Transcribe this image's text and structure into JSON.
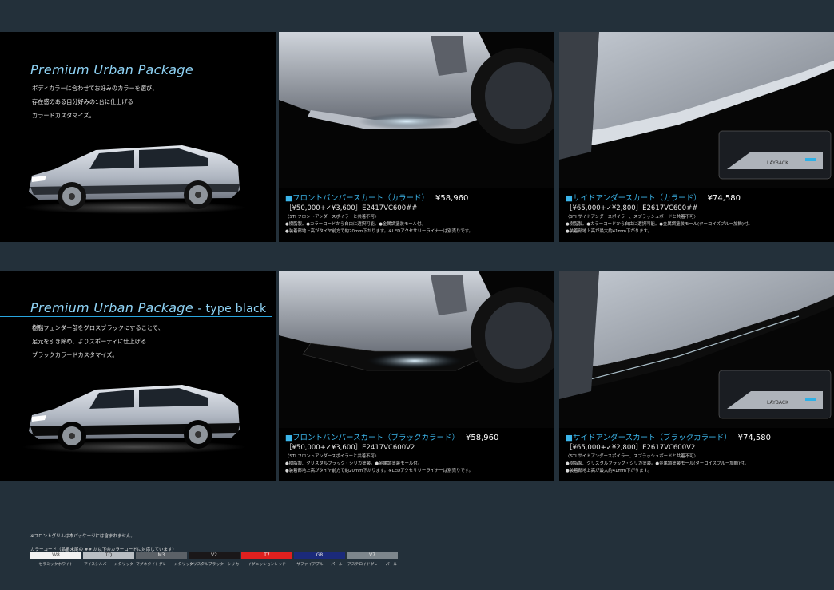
{
  "section1": {
    "title": "Premium Urban Package",
    "desc": [
      "ボディカラーに合わせてお好みのカラーを選び、",
      "存在感のある自分好みの1台に仕上げる",
      "カラードカスタマイズ。"
    ],
    "product_a": {
      "name": "■フロントバンパースカート（カラード）",
      "price": "¥58,960",
      "code": "［¥50,000+✓¥3,600］E2417VC600##",
      "notes": [
        "〈STI フロントアンダースポイラーと共着不可〉",
        "●樹脂製。●カラーコードから自由に選択可能。●金属調塗装モール付。",
        "●装着部地上高がタイヤ前方で約20mm下がります。※LEDアクセサリーライナーは別売りです。"
      ]
    },
    "product_b": {
      "name": "■サイドアンダースカート（カラード）",
      "price": "¥74,580",
      "code": "［¥65,000+✓¥2,800］E2617VC600##",
      "notes": [
        "〈STI サイドアンダースポイラー、スプラッシュボードと共着不可〉",
        "●樹脂製。●カラーコードから自由に選択可能。●金属調塗装モール(ターコイズブルー加飾)付。",
        "●装着部地上高が最大約41mm下がります。"
      ],
      "badge": "LAYBACK"
    }
  },
  "section2": {
    "title": "Premium Urban Package",
    "title_suffix": "- type black",
    "desc": [
      "樹脂フェンダー部をグロスブラックにすることで、",
      "足元を引き締め、よりスポーティに仕上げる",
      "ブラックカラードカスタマイズ。"
    ],
    "product_a": {
      "name": "■フロントバンパースカート（ブラックカラード）",
      "price": "¥58,960",
      "code": "［¥50,000+✓¥3,600］E2417VC600V2",
      "notes": [
        "〈STI フロントアンダースポイラーと共着不可〉",
        "●樹脂製、クリスタルブラック・シリカ塗装。●金属調塗装モール付。",
        "●装着部地上高がタイヤ前方で約20mm下がります。※LEDアクセサリーライナーは別売りです。"
      ]
    },
    "product_b": {
      "name": "■サイドアンダースカート（ブラックカラード）",
      "price": "¥74,580",
      "code": "［¥65,000+✓¥2,800］E2617VC600V2",
      "notes": [
        "〈STI サイドアンダースポイラー、スプラッシュボードと共着不可〉",
        "●樹脂製、クリスタルブラック・シリカ塗装。●金属調塗装モール(ターコイズブルー加飾)付。",
        "●装着部地上高が最大約41mm下がります。"
      ],
      "badge": "LAYBACK"
    }
  },
  "footnote": "※フロントグリルは本パッケージには含まれません。",
  "color_code_title": "カラーコード（品番末尾の ## が以下のカラーコードに対応しています）",
  "colors": [
    {
      "code": "W8",
      "name": "セラミックホワイト",
      "bg": "#f2f2f2",
      "fg": "#333333"
    },
    {
      "code": "TQ",
      "name": "アイスシルバー・メタリック",
      "bg": "#b9bec3",
      "fg": "#333333"
    },
    {
      "code": "M3",
      "name": "マグネタイトグレー・メタリック",
      "bg": "#5b6167",
      "fg": "#e0e0e0"
    },
    {
      "code": "V2",
      "name": "クリスタルブラック・シリカ",
      "bg": "#1a1718",
      "fg": "#dddddd"
    },
    {
      "code": "T7",
      "name": "イグニッションレッド",
      "bg": "#e0201f",
      "fg": "#ffffff"
    },
    {
      "code": "G8",
      "name": "サファイアブルー・パール",
      "bg": "#1b2a7a",
      "fg": "#e0e0e0"
    },
    {
      "code": "V7",
      "name": "アステロイドグレー・パール",
      "bg": "#7d868c",
      "fg": "#e8e8e8"
    }
  ],
  "colors_meta": {
    "accent": "#29a6e0",
    "page_bg": "#23303a"
  }
}
